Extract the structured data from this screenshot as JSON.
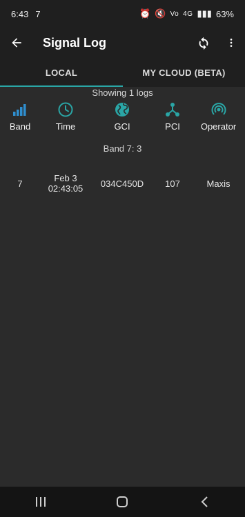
{
  "status": {
    "time": "6:43",
    "notif": "7",
    "net1": "Vo",
    "net2": "4G",
    "battery": "63%"
  },
  "app_bar": {
    "title": "Signal Log"
  },
  "tabs": {
    "local": "LOCAL",
    "cloud": "MY CLOUD (BETA)"
  },
  "summary": "Showing 1 logs",
  "columns": {
    "band": "Band",
    "time": "Time",
    "gci": "GCI",
    "pci": "PCI",
    "operator": "Operator"
  },
  "group_header": "Band 7: 3",
  "rows": [
    {
      "band": "7",
      "date": "Feb 3",
      "time": "02:43:05",
      "gci": "034C450D",
      "pci": "107",
      "operator": "Maxis"
    }
  ],
  "colors": {
    "accent": "#2aa6a6",
    "band_icon": "#2f8fd0"
  }
}
